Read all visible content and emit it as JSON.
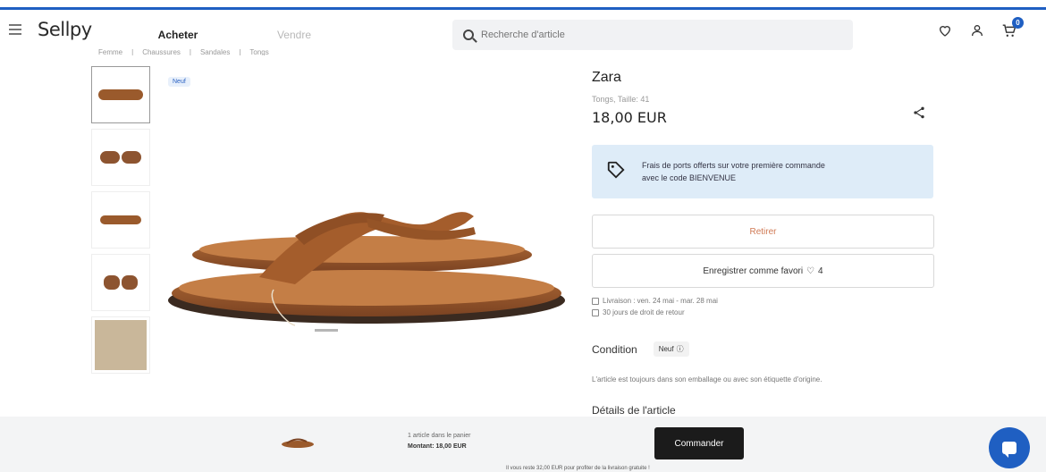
{
  "header": {
    "logo": "Sellpy",
    "tabs": [
      {
        "label": "Acheter",
        "active": true
      },
      {
        "label": "Vendre",
        "active": false
      }
    ],
    "search_placeholder": "Recherche d'article",
    "cart_count": "0"
  },
  "breadcrumb": [
    "Femme",
    "Chaussures",
    "Sandales",
    "Tongs"
  ],
  "product": {
    "badge": "Neuf",
    "brand": "Zara",
    "subinfo": "Tongs, Taille: 41",
    "price": "18,00 EUR",
    "promo_line1": "Frais de ports offerts sur votre première commande",
    "promo_line2": "avec le code BIENVENUE",
    "retirer_label": "Retirer",
    "fav_label": "Enregistrer comme favori",
    "fav_count": "4",
    "delivery_line": "Livraison : ven. 24 mai - mar. 28 mai",
    "return_line": "30 jours de droit de retour",
    "condition_label": "Condition",
    "condition_value": "Neuf",
    "condition_desc": "L'article est toujours dans son emballage ou avec son étiquette d'origine.",
    "details_title": "Détails de l'article"
  },
  "bottom_bar": {
    "line1": "1 article dans le panier",
    "line2": "Montant: 18,00 EUR",
    "button_label": "Commander",
    "note": "Il vous reste 32,00 EUR pour profiter de la livraison gratuite !"
  },
  "colors": {
    "accent": "#1f5fc2",
    "promo_bg": "#deecf8",
    "sandal": "#9a5a2c"
  }
}
